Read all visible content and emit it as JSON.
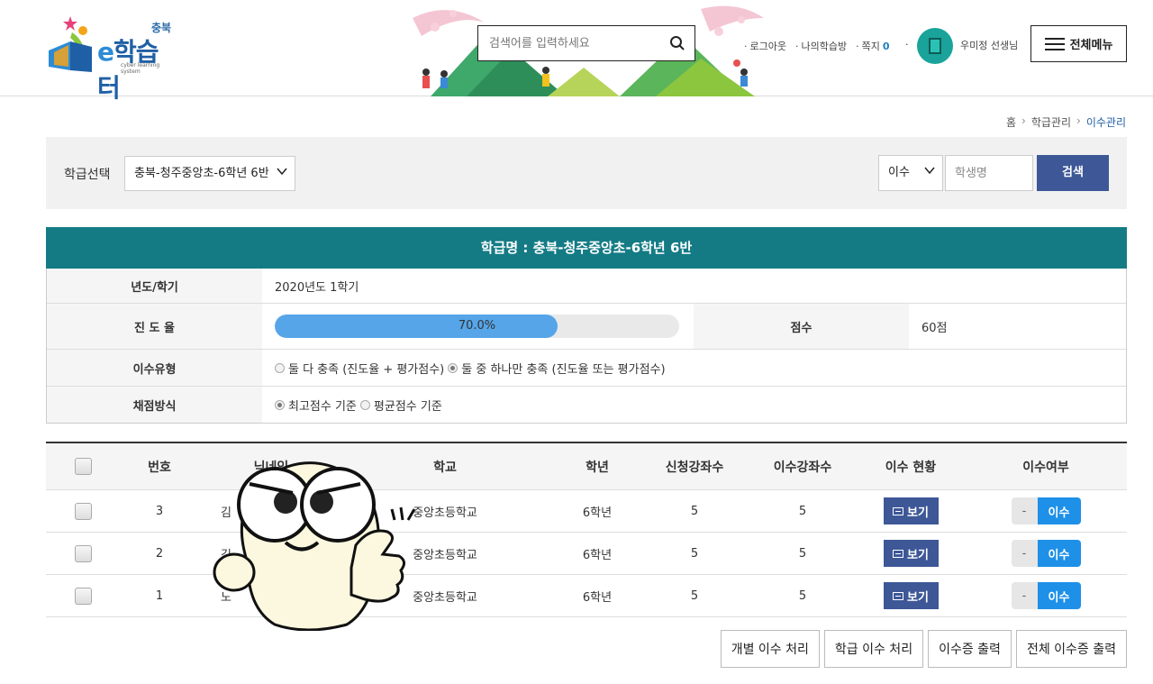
{
  "header": {
    "logo_region": "충북",
    "logo_name_e": "e",
    "logo_name": "학습터",
    "logo_sub": "cyber learning system",
    "search_placeholder": "검색어를 입력하세요",
    "links": {
      "logout": "로그아웃",
      "my_room": "나의학습방",
      "message": "쪽지",
      "message_count": "0"
    },
    "user_name": "우미정 선생님",
    "menu_label": "전체메뉴"
  },
  "breadcrumb": [
    "홈",
    "학급관리",
    "이수관리"
  ],
  "filter": {
    "class_label": "학급선택",
    "class_value": "충북-청주중앙초-6학년 6반",
    "type_value": "이수",
    "student_placeholder": "학생명",
    "search_button": "검색"
  },
  "info": {
    "title": "학급명 : 충북-청주중앙초-6학년 6반",
    "year_label": "년도/학기",
    "year_value": "2020년도 1학기",
    "progress_label": "진 도 율",
    "progress_value": "70.0%",
    "progress_fraction": 0.7,
    "score_label": "점수",
    "score_value": "60점",
    "completion_type_label": "이수유형",
    "completion_type_opt1": "둘 다 충족 (진도율 + 평가점수)",
    "completion_type_opt2": "둘 중 하나만 충족 (진도율 또는 평가점수)",
    "grading_label": "채점방식",
    "grading_opt1": "최고점수 기준",
    "grading_opt2": "평균점수 기준"
  },
  "list": {
    "headers": {
      "no": "번호",
      "nickname": "닉네임",
      "school": "학교",
      "grade": "학년",
      "applied": "신청강좌수",
      "completed": "이수강좌수",
      "status": "이수 현황",
      "done": "이수여부"
    },
    "rows": [
      {
        "no": "3",
        "nickname": "김",
        "school": "중앙초등학교",
        "grade": "6학년",
        "applied": "5",
        "completed": "5",
        "view": "보기",
        "off": "-",
        "on": "이수"
      },
      {
        "no": "2",
        "nickname": "김",
        "school": "중앙초등학교",
        "grade": "6학년",
        "applied": "5",
        "completed": "5",
        "view": "보기",
        "off": "-",
        "on": "이수"
      },
      {
        "no": "1",
        "nickname": "노",
        "school": "중앙초등학교",
        "grade": "6학년",
        "applied": "5",
        "completed": "5",
        "view": "보기",
        "off": "-",
        "on": "이수"
      }
    ]
  },
  "actions": [
    "개별 이수 처리",
    "학급 이수 처리",
    "이수증 출력",
    "전체 이수증 출력"
  ],
  "colors": {
    "brand": "#3d5797",
    "teal": "#147b85",
    "progress": "#55a5e8",
    "toggle_on": "#1e90e8"
  }
}
